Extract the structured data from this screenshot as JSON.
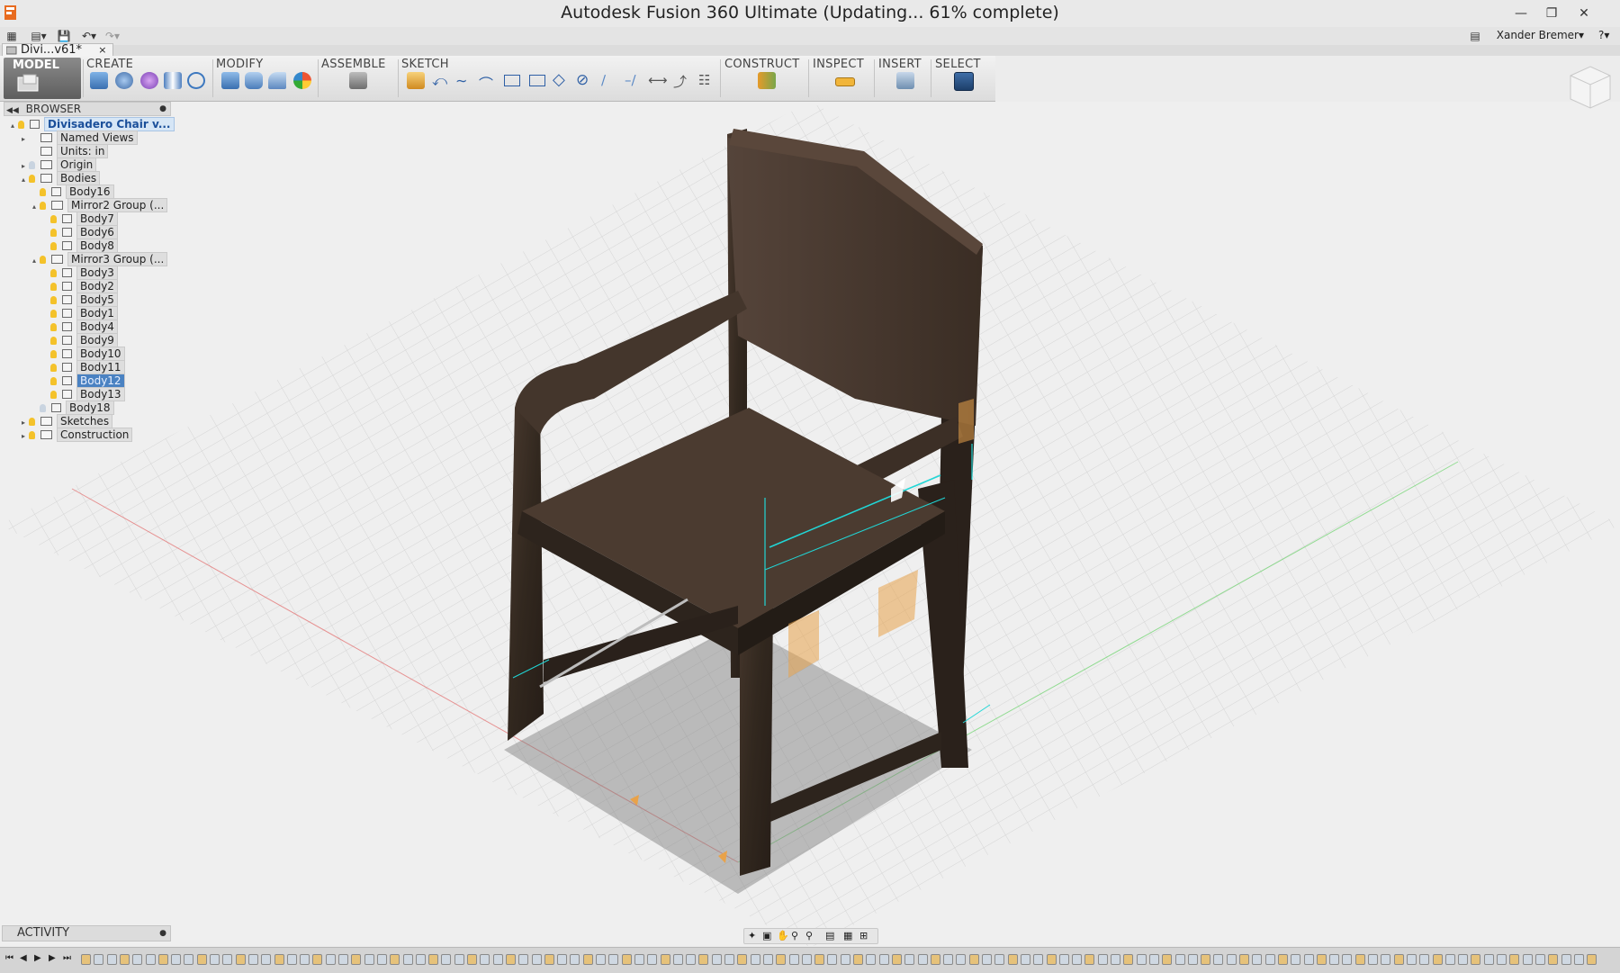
{
  "window": {
    "title": "Autodesk Fusion 360 Ultimate  (Updating... 61% complete)",
    "controls": [
      "minimize-icon",
      "restore-icon",
      "close-icon"
    ],
    "update_progress_percent": 61
  },
  "quick_access": {
    "user": "Xander Bremer",
    "user_caret": "▾",
    "help_label": "?▾"
  },
  "document_tab": {
    "label": "Divi...v61*",
    "close": "×"
  },
  "toolbar": {
    "workspace": "MODEL",
    "groups": [
      "CREATE",
      "MODIFY",
      "ASSEMBLE",
      "SKETCH",
      "CONSTRUCT",
      "INSPECT",
      "INSERT",
      "SELECT"
    ]
  },
  "browser": {
    "title": "BROWSER",
    "tree": [
      {
        "label": "Divisadero Chair v...",
        "depth": 0,
        "expander": "▴",
        "bulb": true,
        "box": true,
        "root": true
      },
      {
        "label": "Named Views",
        "depth": 1,
        "expander": "▸",
        "bulb": false,
        "folder": true
      },
      {
        "label": "Units: in",
        "depth": 1,
        "expander": "",
        "bulb": false,
        "folder": true
      },
      {
        "label": "Origin",
        "depth": 1,
        "expander": "▸",
        "bulb": true,
        "dim": true,
        "folder": true
      },
      {
        "label": "Bodies",
        "depth": 1,
        "expander": "▴",
        "bulb": true,
        "folder": true
      },
      {
        "label": "Body16",
        "depth": 2,
        "expander": "",
        "bulb": true,
        "box": true
      },
      {
        "label": "Mirror2 Group (...",
        "depth": 2,
        "expander": "▴",
        "bulb": true,
        "folder": true
      },
      {
        "label": "Body7",
        "depth": 3,
        "expander": "",
        "bulb": true,
        "box": true
      },
      {
        "label": "Body6",
        "depth": 3,
        "expander": "",
        "bulb": true,
        "box": true
      },
      {
        "label": "Body8",
        "depth": 3,
        "expander": "",
        "bulb": true,
        "box": true
      },
      {
        "label": "Mirror3 Group (...",
        "depth": 2,
        "expander": "▴",
        "bulb": true,
        "folder": true
      },
      {
        "label": "Body3",
        "depth": 3,
        "expander": "",
        "bulb": true,
        "box": true
      },
      {
        "label": "Body2",
        "depth": 3,
        "expander": "",
        "bulb": true,
        "box": true
      },
      {
        "label": "Body5",
        "depth": 3,
        "expander": "",
        "bulb": true,
        "box": true
      },
      {
        "label": "Body1",
        "depth": 3,
        "expander": "",
        "bulb": true,
        "box": true
      },
      {
        "label": "Body4",
        "depth": 3,
        "expander": "",
        "bulb": true,
        "box": true
      },
      {
        "label": "Body9",
        "depth": 3,
        "expander": "",
        "bulb": true,
        "box": true
      },
      {
        "label": "Body10",
        "depth": 3,
        "expander": "",
        "bulb": true,
        "box": true
      },
      {
        "label": "Body11",
        "depth": 3,
        "expander": "",
        "bulb": true,
        "box": true
      },
      {
        "label": "Body12",
        "depth": 3,
        "expander": "",
        "bulb": true,
        "box": true,
        "selected": true
      },
      {
        "label": "Body13",
        "depth": 3,
        "expander": "",
        "bulb": true,
        "box": true
      },
      {
        "label": "Body18",
        "depth": 2,
        "expander": "",
        "bulb": true,
        "dim": true,
        "box": true
      },
      {
        "label": "Sketches",
        "depth": 1,
        "expander": "▸",
        "bulb": true,
        "folder": true
      },
      {
        "label": "Construction",
        "depth": 1,
        "expander": "▸",
        "bulb": true,
        "folder": true
      }
    ]
  },
  "activity": {
    "title": "ACTIVITY"
  },
  "colors": {
    "wood_dark": "#2e241d",
    "wood_mid": "#3f3128",
    "selection_blue": "#4a82c2",
    "sketch_cyan": "#21d6d6",
    "bulb_yellow": "#f4c22a",
    "joint_orange": "#e8a24a"
  }
}
